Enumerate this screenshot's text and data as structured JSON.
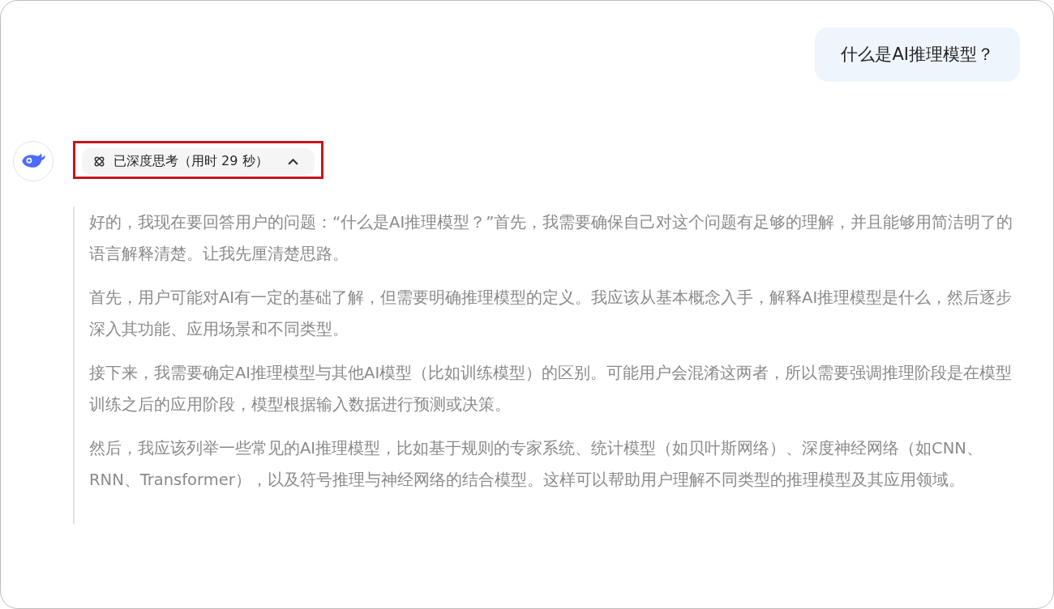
{
  "user_message": {
    "text": "什么是AI推理模型？"
  },
  "thinking_toggle": {
    "label": "已深度思考（用时 29 秒）",
    "expanded": true,
    "highlighted": true
  },
  "thoughts": [
    "好的，我现在要回答用户的问题：“什么是AI推理模型？”首先，我需要确保自己对这个问题有足够的理解，并且能够用简洁明了的语言解释清楚。让我先厘清楚思路。",
    "首先，用户可能对AI有一定的基础了解，但需要明确推理模型的定义。我应该从基本概念入手，解释AI推理模型是什么，然后逐步深入其功能、应用场景和不同类型。",
    "接下来，我需要确定AI推理模型与其他AI模型（比如训练模型）的区别。可能用户会混淆这两者，所以需要强调推理阶段是在模型训练之后的应用阶段，模型根据输入数据进行预测或决策。",
    "然后，我应该列举一些常见的AI推理模型，比如基于规则的专家系统、统计模型（如贝叶斯网络）、深度神经网络（如CNN、RNN、Transformer），以及符号推理与神经网络的结合模型。这样可以帮助用户理解不同类型的推理模型及其应用领域。"
  ]
}
